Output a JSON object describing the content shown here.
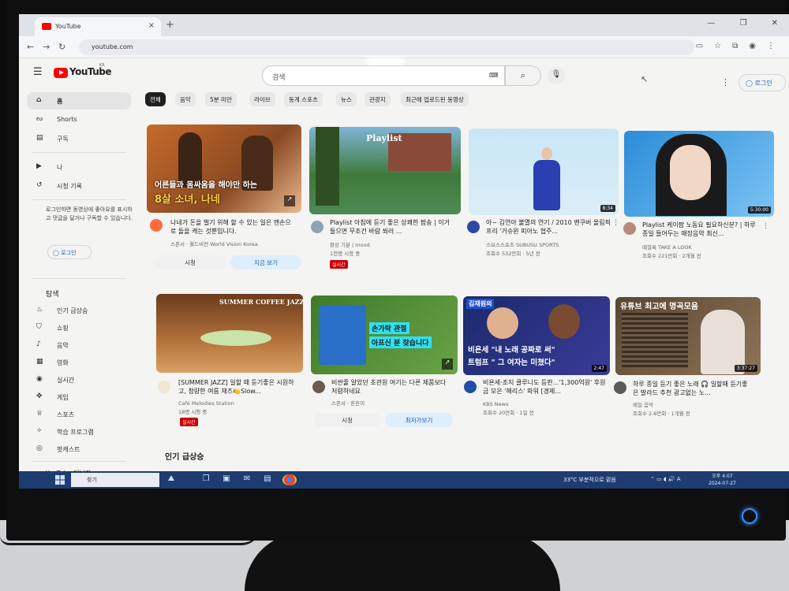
{
  "browser": {
    "tab_title": "YouTube",
    "tab_close": "×",
    "new_tab": "+",
    "url": "youtube.com",
    "window_controls": "—  ❐  ✕"
  },
  "header": {
    "logo_text": "YouTube",
    "logo_region": "KR",
    "search_placeholder": "검색",
    "login_label": "로그인"
  },
  "sidebar": {
    "items": [
      {
        "label": "홈",
        "icon": "home-icon",
        "active": true
      },
      {
        "label": "Shorts",
        "icon": "shorts-icon"
      },
      {
        "label": "구독",
        "icon": "subscriptions-icon"
      },
      {
        "label": "나",
        "icon": "you-icon"
      },
      {
        "label": "시청 기록",
        "icon": "history-icon"
      }
    ],
    "login_prompt": "로그인하면 동영상에 좋아요를 표시하고 댓글을 달거나 구독할 수 있습니다.",
    "login_label": "로그인",
    "explore_heading": "탐색",
    "explore_items": [
      {
        "label": "인기 급상승",
        "icon": "trending-icon"
      },
      {
        "label": "쇼핑",
        "icon": "shopping-icon"
      },
      {
        "label": "음악",
        "icon": "music-icon"
      },
      {
        "label": "영화",
        "icon": "movie-icon"
      },
      {
        "label": "실시간",
        "icon": "live-icon"
      },
      {
        "label": "게임",
        "icon": "gaming-icon"
      },
      {
        "label": "스포츠",
        "icon": "sports-icon"
      },
      {
        "label": "학습 프로그램",
        "icon": "learning-icon"
      },
      {
        "label": "팟캐스트",
        "icon": "podcast-icon"
      }
    ],
    "more_label": "YouTube 더보기"
  },
  "chips": [
    "전체",
    "음악",
    "5분 미만",
    "라이브",
    "동계 스포츠",
    "뉴스",
    "관광지",
    "최근에 업로드된 동영상"
  ],
  "videos_row1": [
    {
      "thumb_text1": "어른들과 몸싸움을 해야만 하는",
      "thumb_text2": "8살 소녀, 나네",
      "title": "나네가 돈을 벌기 위해 할 수 있는 일은 맨손으로 돌을 캐는 것뿐입니다.",
      "channel": "스폰서 · 월드비전 World Vision Korea",
      "btn_watch": "시청",
      "btn_now": "지금 보기"
    },
    {
      "thumb_text1": "Playlist",
      "title": "Playlist 아침에 듣기 좋은 상쾌한 팝송 | 이거 들으면 무조건 바람 쐬러 ...",
      "channel": "항상 기분 | mood",
      "meta": "1천명 시청 중",
      "live": "실시간"
    },
    {
      "duration": "8:34",
      "title": "아~ 김연아 불멸의 연기 / 2010 밴쿠버 올림픽 프리 '거슈윈 피아노 협주...",
      "channel": "스브스스포츠 SUBUSU SPORTS",
      "meta": "조회수 532만회 · 5년 전"
    },
    {
      "duration": "5:30:00",
      "title": "Playlist 케이팝 노동요 필요하신분? | 하루종일 들어두는 매장음악 최신...",
      "channel": "때껄룩 TAKE A LOOK",
      "meta": "조회수 221만회 · 2개월 전"
    }
  ],
  "videos_row2": [
    {
      "thumb_text1": "SUMMER COFFEE JAZZ",
      "title": "[SUMMER JAZZ] 일할 때 듣기좋은 시원하고, 청량한 여름 재즈🍋Slow...",
      "channel": "Café Melodies Station",
      "meta": "18명 시청 중",
      "live": "실시간"
    },
    {
      "thumb_text1": "손가락 관절",
      "thumb_text2": "아프신 분 찾습니다",
      "title": "비싼줄 알았던 초관원 여기는 다른 제품보다 저렴하네요",
      "channel": "스폰서 · 흔흔이",
      "btn_watch": "시청",
      "btn_now": "최저가보기"
    },
    {
      "thumb_tag": "김재원의",
      "thumb_text1": "비욘세 \"내 노래 공짜로 써\"",
      "thumb_text2": "트럼프 \" 그 여자는 미쳤다\"",
      "duration": "2:47",
      "title": "비욘세·조지 클루니도 등판...'1,300억원' 후원금 모은 '해리스' 파워 [경제...",
      "channel": "KBS News",
      "meta": "조회수 20만회 · 1일 전"
    },
    {
      "thumb_text1": "유튜브 최고에 명곡모음",
      "duration": "3:37:27",
      "title": "하루 종일 듣기 좋은 노래 🎧 일할때 듣기좋은 발라드 추천 광고없는 노...",
      "channel": "매일 음악",
      "meta": "조회수 2.8만회 · 1개월 전"
    }
  ],
  "section_title": "인기 급상승",
  "taskbar": {
    "search_placeholder": "찾기",
    "weather": "33°C 부분적으로 맑음",
    "time": "오후 4:07",
    "date": "2024-07-27"
  },
  "colors": {
    "yt_red": "#ff0000",
    "taskbar": "#1e3c72",
    "live_red": "#cc0000",
    "link_blue": "#1a5fb4"
  }
}
